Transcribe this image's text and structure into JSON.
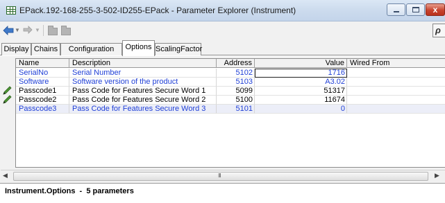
{
  "window": {
    "title": "EPack.192-168-255-3-502-ID255-EPack - Parameter Explorer (Instrument)",
    "close_glyph": "x"
  },
  "toolbar": {
    "back_icon": "arrow-left-icon",
    "forward_icon": "arrow-right-icon",
    "search_glyph": "ρ"
  },
  "tabs": [
    {
      "label": "Display",
      "active": false
    },
    {
      "label": "Chains",
      "active": false
    },
    {
      "label": "Configuration",
      "active": false
    },
    {
      "label": "Options",
      "active": true
    },
    {
      "label": "ScalingFactor",
      "active": false
    }
  ],
  "grid": {
    "columns": [
      "Name",
      "Description",
      "Address",
      "Value",
      "Wired From"
    ],
    "rows": [
      {
        "name": "SerialNo",
        "description": "Serial Number",
        "address": "5102",
        "value": "1716",
        "wired_from": "",
        "editable": false,
        "style": "blue"
      },
      {
        "name": "Software",
        "description": "Software version of the product",
        "address": "5103",
        "value": "A3.02",
        "wired_from": "",
        "editable": false,
        "style": "blue"
      },
      {
        "name": "Passcode1",
        "description": "Pass Code for Features Secure Word 1",
        "address": "5099",
        "value": "51317",
        "wired_from": "",
        "editable": true,
        "style": "black"
      },
      {
        "name": "Passcode2",
        "description": "Pass Code for Features Secure Word 2",
        "address": "5100",
        "value": "11674",
        "wired_from": "",
        "editable": true,
        "style": "black"
      },
      {
        "name": "Passcode3",
        "description": "Pass Code for Features Secure Word 3",
        "address": "5101",
        "value": "0",
        "wired_from": "",
        "editable": false,
        "style": "blue"
      }
    ]
  },
  "scrollbar": {
    "grip": "III"
  },
  "status": {
    "text": "Instrument.Options  -  5 parameters"
  },
  "colors": {
    "read_only_text": "#1f3fd6",
    "title_bar": "#cddcee",
    "close_button": "#c8432e",
    "pencil": "#3c8a2a"
  }
}
